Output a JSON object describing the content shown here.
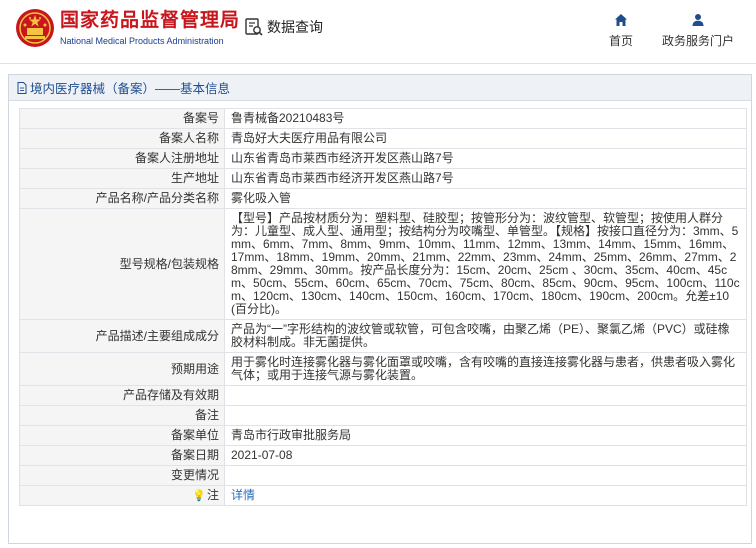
{
  "header": {
    "brand_cn": "国家药品监督管理局",
    "brand_en": "National Medical Products Administration",
    "query_label": "数据查询",
    "nav": [
      {
        "label": "首页",
        "icon": "home-icon"
      },
      {
        "label": "政务服务门户",
        "icon": "user-icon"
      }
    ]
  },
  "panel": {
    "title": "境内医疗器械（备案）——基本信息"
  },
  "record": {
    "rows": [
      {
        "label": "备案号",
        "value": "鲁青械备20210483号"
      },
      {
        "label": "备案人名称",
        "value": "青岛好大夫医疗用品有限公司"
      },
      {
        "label": "备案人注册地址",
        "value": "山东省青岛市莱西市经济开发区燕山路7号"
      },
      {
        "label": "生产地址",
        "value": "山东省青岛市莱西市经济开发区燕山路7号"
      },
      {
        "label": "产品名称/产品分类名称",
        "value": "雾化吸入管"
      },
      {
        "label": "型号规格/包装规格",
        "value": "【型号】产品按材质分为：塑料型、硅胶型；按管形分为：波纹管型、软管型；按使用人群分为：儿童型、成人型、通用型；按结构分为咬嘴型、单管型。【规格】按接口直径分为：3mm、5mm、6mm、7mm、8mm、9mm、10mm、11mm、12mm、13mm、14mm、15mm、16mm、17mm、18mm、19mm、20mm、21mm、22mm、23mm、24mm、25mm、26mm、27mm、28mm、29mm、30mm。按产品长度分为：15cm、20cm、25cm 、30cm、35cm、40cm、45cm、50cm、55cm、60cm、65cm、70cm、75cm、80cm、85cm、90cm、95cm、100cm、110cm、120cm、130cm、140cm、150cm、160cm、170cm、180cm、190cm、200cm。允差±10(百分比)。"
      },
      {
        "label": "产品描述/主要组成成分",
        "value": "产品为“一”字形结构的波纹管或软管，可包含咬嘴，由聚乙烯（PE）、聚氯乙烯（PVC）或硅橡胶材料制成。非无菌提供。"
      },
      {
        "label": "预期用途",
        "value": "用于雾化时连接雾化器与雾化面罩或咬嘴，含有咬嘴的直接连接雾化器与患者，供患者吸入雾化气体；或用于连接气源与雾化装置。"
      },
      {
        "label": "产品存储及有效期",
        "value": ""
      },
      {
        "label": "备注",
        "value": ""
      },
      {
        "label": "备案单位",
        "value": "青岛市行政审批服务局"
      },
      {
        "label": "备案日期",
        "value": "2021-07-08"
      },
      {
        "label": "变更情况",
        "value": ""
      }
    ],
    "note_row": {
      "label": "注",
      "link": "详情",
      "icon": "lightbulb-icon"
    }
  }
}
